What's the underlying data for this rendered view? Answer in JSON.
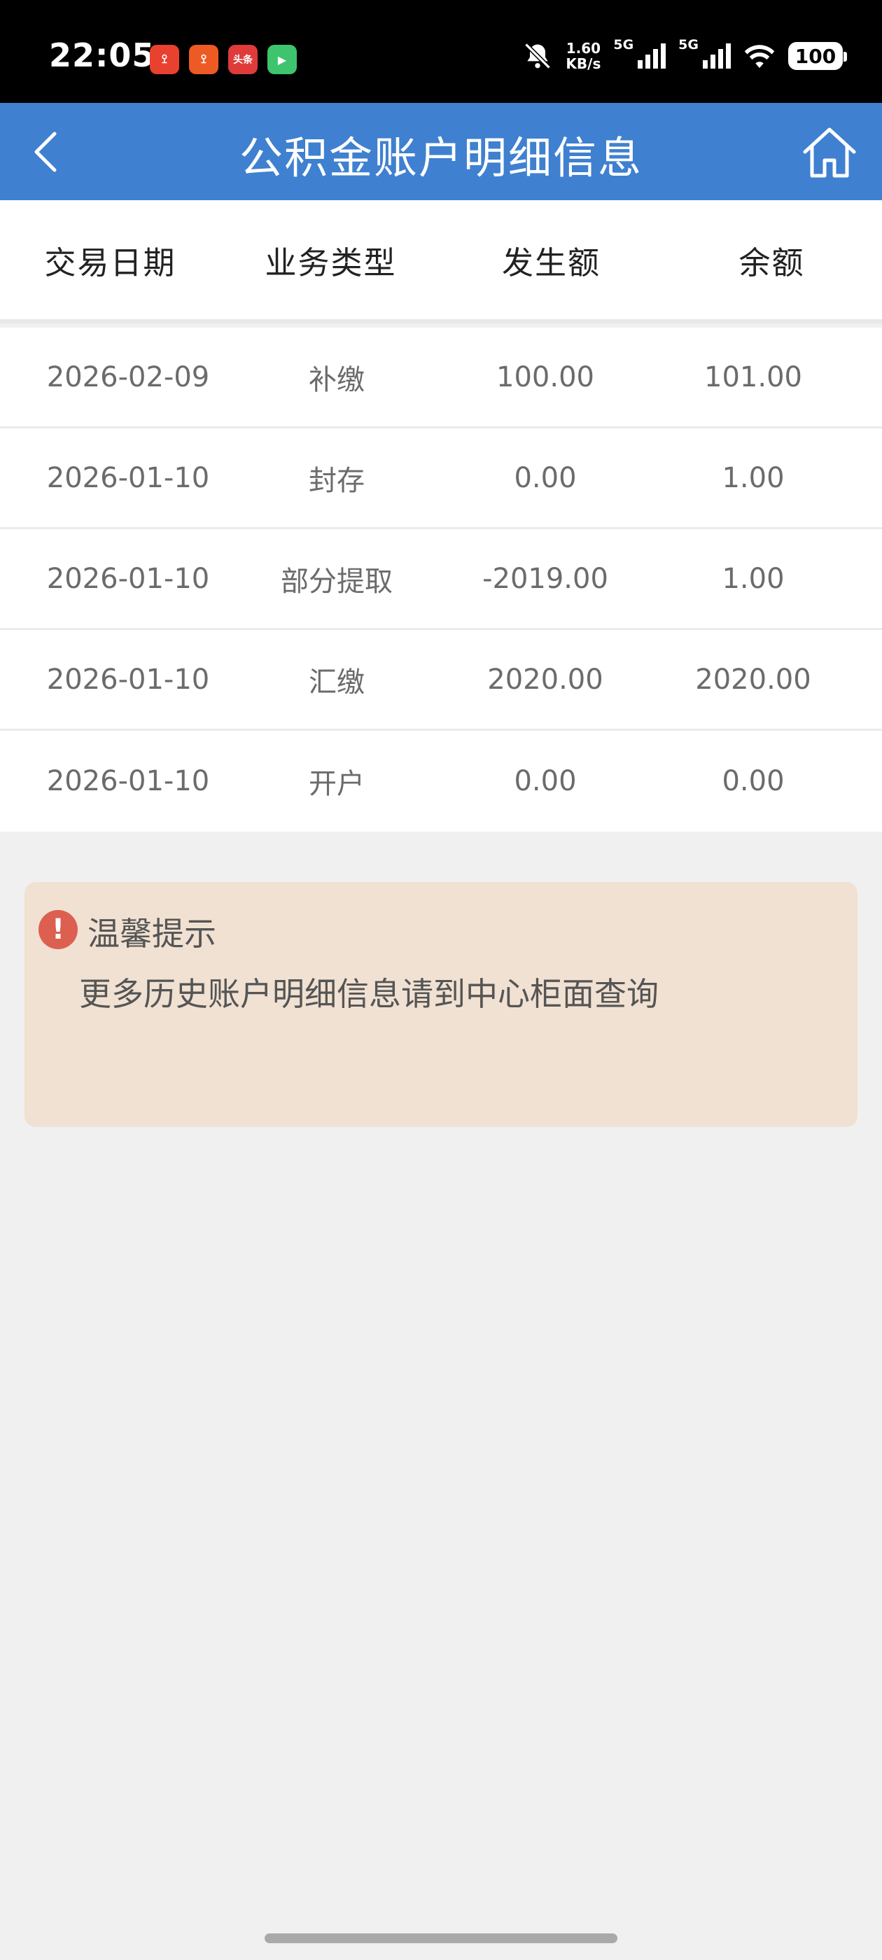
{
  "status_bar": {
    "time": "22:05",
    "net_speed_value": "1.60",
    "net_speed_unit": "KB/s",
    "sim1_gen": "5G",
    "sim2_gen": "5G",
    "battery": "100",
    "notif_icons": [
      {
        "name": "app-icon-1",
        "color": "#e8412f",
        "label": "ꔌ"
      },
      {
        "name": "app-icon-2",
        "color": "#ee5a24",
        "label": "ꔌ"
      },
      {
        "name": "app-icon-3",
        "color": "#e03b3b",
        "label": "头条"
      },
      {
        "name": "app-icon-4",
        "color": "#3ec46d",
        "label": "▶"
      }
    ]
  },
  "nav": {
    "title": "公积金账户明细信息",
    "accent_color": "#3f80d0"
  },
  "table": {
    "headers": [
      "交易日期",
      "业务类型",
      "发生额",
      "余额"
    ],
    "rows": [
      {
        "date": "2026-02-09",
        "type": "补缴",
        "amount": "100.00",
        "balance": "101.00"
      },
      {
        "date": "2026-01-10",
        "type": "封存",
        "amount": "0.00",
        "balance": "1.00"
      },
      {
        "date": "2026-01-10",
        "type": "部分提取",
        "amount": "-2019.00",
        "balance": "1.00"
      },
      {
        "date": "2026-01-10",
        "type": "汇缴",
        "amount": "2020.00",
        "balance": "2020.00"
      },
      {
        "date": "2026-01-10",
        "type": "开户",
        "amount": "0.00",
        "balance": "0.00"
      }
    ]
  },
  "tip": {
    "icon": "!",
    "title": "温馨提示",
    "text": "更多历史账户明细信息请到中心柜面查询",
    "bg_color": "#f0e1d3"
  }
}
